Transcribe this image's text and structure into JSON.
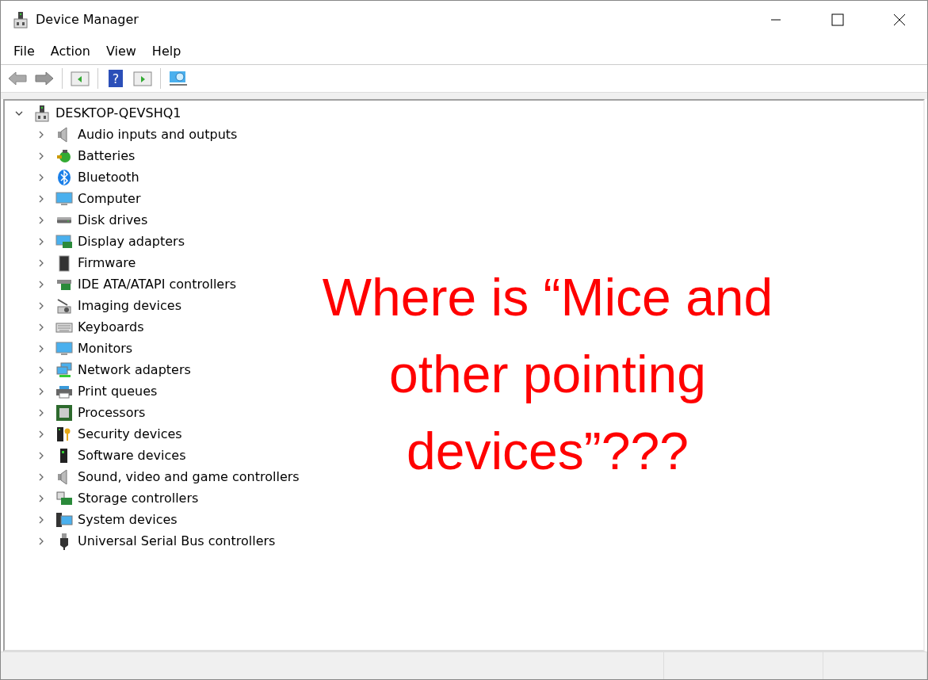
{
  "window": {
    "title": "Device Manager"
  },
  "menu": [
    "File",
    "Action",
    "View",
    "Help"
  ],
  "toolbar": {
    "help_glyph": "?"
  },
  "tree": {
    "label": "DESKTOP-QEVSHQ1",
    "expanded": true,
    "children": [
      {
        "label": "Audio inputs and outputs",
        "expanded": false
      },
      {
        "label": "Batteries",
        "expanded": false
      },
      {
        "label": "Bluetooth",
        "expanded": false
      },
      {
        "label": "Computer",
        "expanded": false
      },
      {
        "label": "Disk drives",
        "expanded": false
      },
      {
        "label": "Display adapters",
        "expanded": false
      },
      {
        "label": "Firmware",
        "expanded": false
      },
      {
        "label": "IDE ATA/ATAPI controllers",
        "expanded": false
      },
      {
        "label": "Imaging devices",
        "expanded": false
      },
      {
        "label": "Keyboards",
        "expanded": false
      },
      {
        "label": "Monitors",
        "expanded": false
      },
      {
        "label": "Network adapters",
        "expanded": false
      },
      {
        "label": "Print queues",
        "expanded": false
      },
      {
        "label": "Processors",
        "expanded": false
      },
      {
        "label": "Security devices",
        "expanded": false
      },
      {
        "label": "Software devices",
        "expanded": false
      },
      {
        "label": "Sound, video and game controllers",
        "expanded": false
      },
      {
        "label": "Storage controllers",
        "expanded": false
      },
      {
        "label": "System devices",
        "expanded": false
      },
      {
        "label": "Universal Serial Bus controllers",
        "expanded": false
      }
    ]
  },
  "annotation": [
    "Where is “Mice and",
    "other pointing",
    "devices”???"
  ]
}
